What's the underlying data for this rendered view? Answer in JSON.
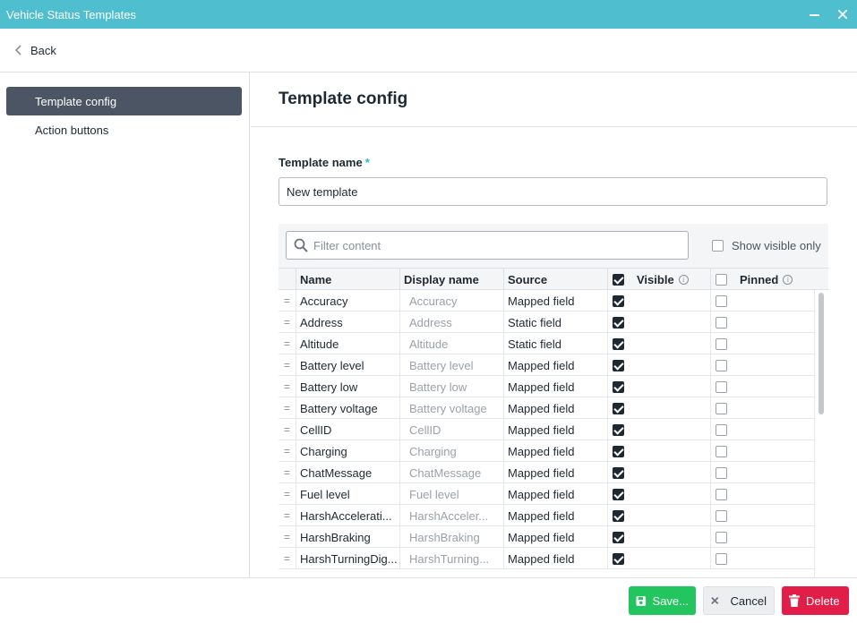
{
  "window": {
    "title": "Vehicle Status Templates",
    "minimize_icon": "minimize-icon",
    "close_icon": "close-icon"
  },
  "nav": {
    "back_label": "Back"
  },
  "sidebar": {
    "items": [
      {
        "label": "Template config",
        "active": true
      },
      {
        "label": "Action buttons",
        "active": false
      }
    ]
  },
  "main": {
    "title": "Template config",
    "template_name_label": "Template name",
    "required_mark": "*",
    "template_name_value": "New template",
    "filter_placeholder": "Filter content",
    "show_visible_only_label": "Show visible only",
    "show_visible_only_checked": false
  },
  "table": {
    "columns": {
      "name": "Name",
      "display_name": "Display name",
      "source": "Source",
      "visible": "Visible",
      "pinned": "Pinned"
    },
    "header_visible_checked": true,
    "header_pinned_checked": false,
    "rows": [
      {
        "name": "Accuracy",
        "display_placeholder": "Accuracy",
        "source": "Mapped field",
        "visible": true,
        "pinned": false
      },
      {
        "name": "Address",
        "display_placeholder": "Address",
        "source": "Static field",
        "visible": true,
        "pinned": false
      },
      {
        "name": "Altitude",
        "display_placeholder": "Altitude",
        "source": "Static field",
        "visible": true,
        "pinned": false
      },
      {
        "name": "Battery level",
        "display_placeholder": "Battery level",
        "source": "Mapped field",
        "visible": true,
        "pinned": false
      },
      {
        "name": "Battery low",
        "display_placeholder": "Battery low",
        "source": "Mapped field",
        "visible": true,
        "pinned": false
      },
      {
        "name": "Battery voltage",
        "display_placeholder": "Battery voltage",
        "source": "Mapped field",
        "visible": true,
        "pinned": false
      },
      {
        "name": "CellID",
        "display_placeholder": "CellID",
        "source": "Mapped field",
        "visible": true,
        "pinned": false
      },
      {
        "name": "Charging",
        "display_placeholder": "Charging",
        "source": "Mapped field",
        "visible": true,
        "pinned": false
      },
      {
        "name": "ChatMessage",
        "display_placeholder": "ChatMessage",
        "source": "Mapped field",
        "visible": true,
        "pinned": false
      },
      {
        "name": "Fuel level",
        "display_placeholder": "Fuel level",
        "source": "Mapped field",
        "visible": true,
        "pinned": false
      },
      {
        "name": "HarshAccelerati...",
        "display_placeholder": "HarshAcceler...",
        "source": "Mapped field",
        "visible": true,
        "pinned": false
      },
      {
        "name": "HarshBraking",
        "display_placeholder": "HarshBraking",
        "source": "Mapped field",
        "visible": true,
        "pinned": false
      },
      {
        "name": "HarshTurningDig...",
        "display_placeholder": "HarshTurning...",
        "source": "Mapped field",
        "visible": true,
        "pinned": false
      }
    ]
  },
  "footer": {
    "save_label": "Save...",
    "cancel_label": "Cancel",
    "delete_label": "Delete"
  },
  "colors": {
    "titlebar": "#4fbecf",
    "sidebar_active": "#4b5563",
    "save": "#22c55e",
    "delete": "#e11d48",
    "required": "#2bb8c9"
  }
}
